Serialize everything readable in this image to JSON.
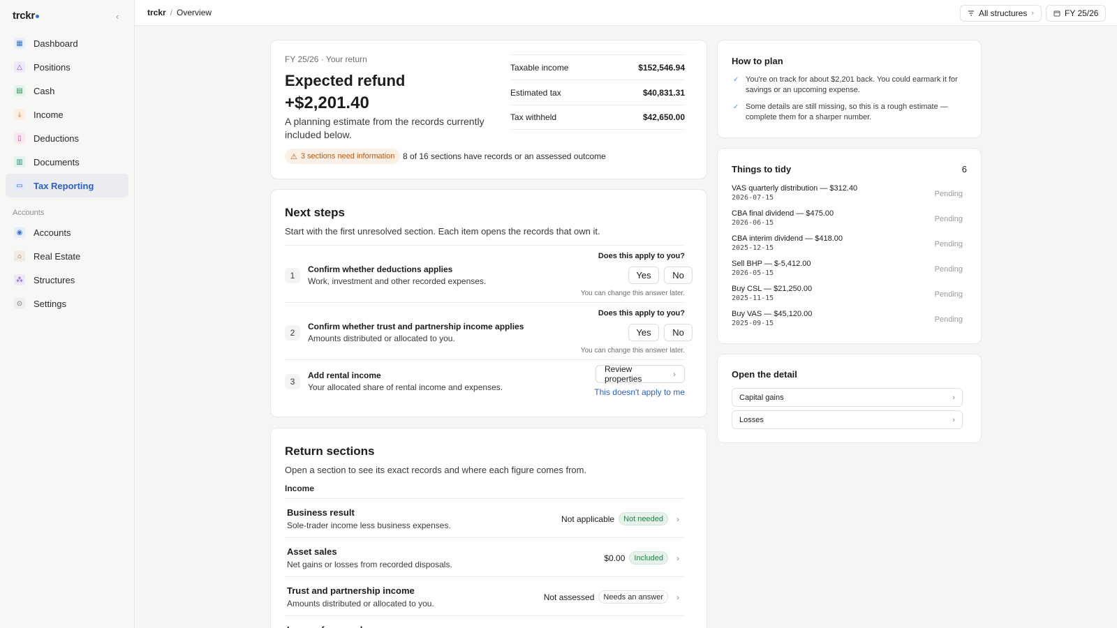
{
  "app": {
    "brand": "trckr"
  },
  "sidebar": {
    "collapse_glyph": "‹",
    "items": [
      {
        "label": "Dashboard",
        "icon": "dashboard-icon",
        "color": "#3a73c9",
        "bg": "#e6eefb"
      },
      {
        "label": "Positions",
        "icon": "positions-icon",
        "color": "#7a4fc7",
        "bg": "#efe8fb"
      },
      {
        "label": "Cash",
        "icon": "cash-icon",
        "color": "#2e8b57",
        "bg": "#e3f3ea"
      },
      {
        "label": "Income",
        "icon": "income-icon",
        "color": "#d9702b",
        "bg": "#fdeee2"
      },
      {
        "label": "Deductions",
        "icon": "deductions-icon",
        "color": "#d2448b",
        "bg": "#fbe7f1"
      },
      {
        "label": "Documents",
        "icon": "documents-icon",
        "color": "#2f8f7a",
        "bg": "#e2f2ee"
      },
      {
        "label": "Tax Reporting",
        "icon": "tax-reporting-icon",
        "color": "#2d5fc4",
        "bg": "#e3ebfa",
        "active": true
      }
    ],
    "group_label": "Accounts",
    "account_items": [
      {
        "label": "Accounts",
        "icon": "accounts-icon",
        "color": "#3a73c9",
        "bg": "#e6eefb"
      },
      {
        "label": "Real Estate",
        "icon": "real-estate-icon",
        "color": "#8a6a4a",
        "bg": "#f1ebe4"
      },
      {
        "label": "Structures",
        "icon": "structures-icon",
        "color": "#7a4fc7",
        "bg": "#efe8fb"
      },
      {
        "label": "Settings",
        "icon": "settings-icon",
        "color": "#6e6e6c",
        "bg": "#ededec"
      }
    ]
  },
  "topbar": {
    "breadcrumb_root": "trckr",
    "breadcrumb_sep": "/",
    "breadcrumb_page": "Overview",
    "structures_label": "All structures",
    "fy_label": "FY 25/26"
  },
  "summary": {
    "eyebrow": "FY 25/26 · Your return",
    "title": "Expected refund",
    "amount": "+$2,201.40",
    "description": "A planning estimate from the records currently included below.",
    "warning": "3 sections need information",
    "meta": "8 of 16 sections have records or an assessed outcome",
    "figures": [
      {
        "label": "Taxable income",
        "value": "$152,546.94"
      },
      {
        "label": "Estimated tax",
        "value": "$40,831.31"
      },
      {
        "label": "Tax withheld",
        "value": "$42,650.00"
      }
    ]
  },
  "next_steps": {
    "title": "Next steps",
    "subtitle": "Start with the first unresolved section. Each item opens the records that own it.",
    "question": "Does this apply to you?",
    "yes": "Yes",
    "no": "No",
    "note": "You can change this answer later.",
    "steps": [
      {
        "num": "1",
        "title": "Confirm whether deductions applies",
        "desc": "Work, investment and other recorded expenses."
      },
      {
        "num": "2",
        "title": "Confirm whether trust and partnership income applies",
        "desc": "Amounts distributed or allocated to you."
      },
      {
        "num": "3",
        "title": "Add rental income",
        "desc": "Your allocated share of rental income and expenses.",
        "action": "Review properties",
        "link": "This doesn't apply to me"
      }
    ]
  },
  "return_sections": {
    "title": "Return sections",
    "subtitle": "Open a section to see its exact records and where each figure comes from.",
    "group": "Income",
    "rows": [
      {
        "title": "Business result",
        "desc": "Sole-trader income less business expenses.",
        "value": "Not applicable",
        "badge": "Not needed",
        "badge_style": "green"
      },
      {
        "title": "Asset sales",
        "desc": "Net gains or losses from recorded disposals.",
        "value": "$0.00",
        "badge": "Included",
        "badge_style": "green"
      },
      {
        "title": "Trust and partnership income",
        "desc": "Amounts distributed or allocated to you.",
        "value": "Not assessed",
        "badge": "Needs an answer",
        "badge_style": "outline"
      },
      {
        "title": "Income from work",
        "desc": "",
        "value": "",
        "badge": "",
        "badge_style": "outline"
      }
    ]
  },
  "how_to_plan": {
    "title": "How to plan",
    "items": [
      "You're on track for about $2,201 back. You could earmark it for savings or an upcoming expense.",
      "Some details are still missing, so this is a rough estimate — complete them for a sharper number."
    ]
  },
  "tidy": {
    "title": "Things to tidy",
    "count": "6",
    "items": [
      {
        "title": "VAS quarterly distribution — $312.40",
        "date": "2026-07-15",
        "status": "Pending"
      },
      {
        "title": "CBA final dividend — $475.00",
        "date": "2026-06-15",
        "status": "Pending"
      },
      {
        "title": "CBA interim dividend — $418.00",
        "date": "2025-12-15",
        "status": "Pending"
      },
      {
        "title": "Sell BHP — $-5,412.00",
        "date": "2026-05-15",
        "status": "Pending"
      },
      {
        "title": "Buy CSL — $21,250.00",
        "date": "2025-11-15",
        "status": "Pending"
      },
      {
        "title": "Buy VAS — $45,120.00",
        "date": "2025-09-15",
        "status": "Pending"
      }
    ]
  },
  "detail": {
    "title": "Open the detail",
    "links": [
      "Capital gains",
      "Losses"
    ]
  }
}
